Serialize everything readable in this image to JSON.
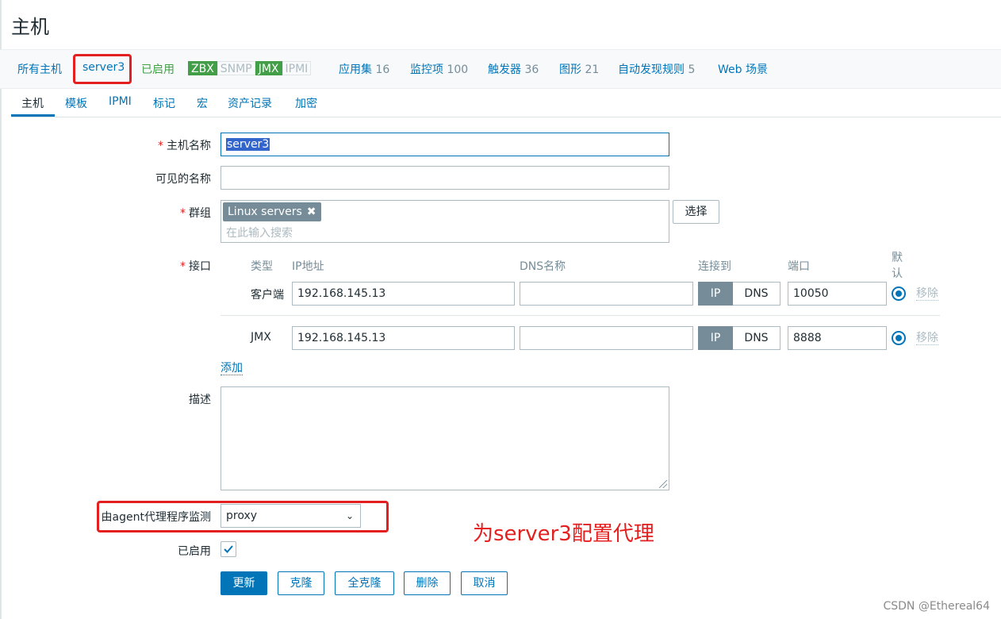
{
  "page": {
    "title": "主机"
  },
  "host_nav": {
    "all_hosts": "所有主机",
    "host_name": "server3",
    "status": "已启用",
    "availability": [
      {
        "label": "ZBX",
        "state": "on"
      },
      {
        "label": "SNMP",
        "state": "off"
      },
      {
        "label": "JMX",
        "state": "on"
      },
      {
        "label": "IPMI",
        "state": "off"
      }
    ],
    "applications": {
      "label": "应用集",
      "count": "16"
    },
    "items": {
      "label": "监控项",
      "count": "100"
    },
    "triggers": {
      "label": "触发器",
      "count": "36"
    },
    "graphs": {
      "label": "图形",
      "count": "21"
    },
    "discovery": {
      "label": "自动发现规则",
      "count": "5"
    },
    "web": {
      "label": "Web 场景"
    }
  },
  "tabs": [
    "主机",
    "模板",
    "IPMI",
    "标记",
    "宏",
    "资产记录",
    "加密"
  ],
  "form": {
    "host_name": {
      "label": "主机名称",
      "value": "server3"
    },
    "visible_name": {
      "label": "可见的名称",
      "value": ""
    },
    "groups": {
      "label": "群组",
      "chip": "Linux servers",
      "chip_remove": "✖",
      "placeholder": "在此输入搜索",
      "select_button": "选择"
    },
    "interfaces": {
      "label": "接口",
      "headers": {
        "type": "类型",
        "ip": "IP地址",
        "dns": "DNS名称",
        "connect": "连接到",
        "port": "端口",
        "default": "默认"
      },
      "rows": [
        {
          "type": "客户端",
          "ip": "192.168.145.13",
          "dns": "",
          "ip_btn": "IP",
          "dns_btn": "DNS",
          "port": "10050",
          "remove": "移除"
        },
        {
          "type": "JMX",
          "ip": "192.168.145.13",
          "dns": "",
          "ip_btn": "IP",
          "dns_btn": "DNS",
          "port": "8888",
          "remove": "移除"
        }
      ],
      "add": "添加"
    },
    "description": {
      "label": "描述",
      "value": ""
    },
    "proxy": {
      "label": "由agent代理程序监测",
      "value": "proxy"
    },
    "enabled": {
      "label": "已启用",
      "checked": true
    }
  },
  "buttons": {
    "update": "更新",
    "clone": "克隆",
    "full_clone": "全克隆",
    "delete": "删除",
    "cancel": "取消"
  },
  "annotation": "为server3配置代理",
  "watermark": "CSDN @Ethereal64",
  "colors": {
    "accent": "#0275b8",
    "green": "#429e47",
    "red": "#e41f1f",
    "gray": "#768d99"
  }
}
